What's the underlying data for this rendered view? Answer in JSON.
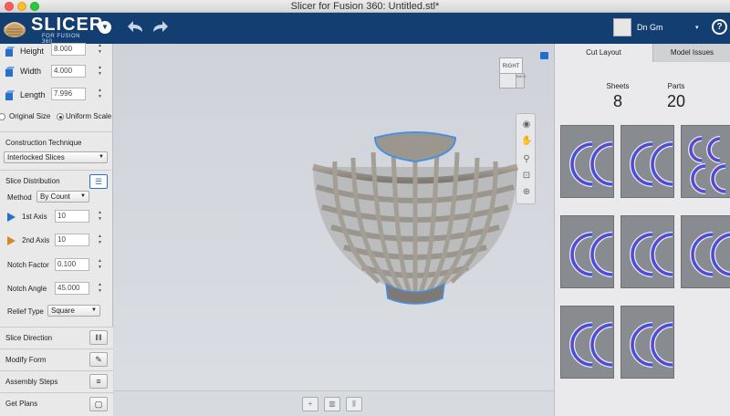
{
  "window": {
    "title": "Slicer for Fusion 360: Untitled.stl*"
  },
  "toolbar": {
    "logo_title": "SLICER",
    "logo_subtitle": "FOR FUSION 360",
    "menu_icon": "chevron-down-icon",
    "user_name": "Dn Gm",
    "user_caret": "▾",
    "help_label": "?"
  },
  "dimensions": {
    "height_label": "Height",
    "height_value": "8.000",
    "width_label": "Width",
    "width_value": "4.000",
    "length_label": "Length",
    "length_value": "7.996"
  },
  "size_mode": {
    "original_label": "Original Size",
    "uniform_label": "Uniform Scale",
    "selected": "Uniform Scale"
  },
  "construction": {
    "title": "Construction Technique",
    "value": "Interlocked Slices"
  },
  "slice_distribution": {
    "title": "Slice Distribution",
    "method_label": "Method",
    "method_value": "By Count",
    "axis1_label": "1st Axis",
    "axis1_value": "10",
    "axis2_label": "2nd Axis",
    "axis2_value": "10",
    "notch_factor_label": "Notch Factor",
    "notch_factor_value": "0.100",
    "notch_angle_label": "Notch Angle",
    "notch_angle_value": "45.000",
    "relief_label": "Relief Type",
    "relief_value": "Square"
  },
  "bottom_items": {
    "slice_direction": "Slice Direction",
    "modify_form": "Modify Form",
    "assembly_steps": "Assembly Steps",
    "get_plans": "Get Plans"
  },
  "viewcube": {
    "front_label": "RIGHT",
    "side_label": "BACK"
  },
  "right_panel": {
    "tab_cut_layout": "Cut Layout",
    "tab_model_issues": "Model Issues",
    "sheets_label": "Sheets",
    "sheets_value": "8",
    "parts_label": "Parts",
    "parts_value": "20"
  },
  "colors": {
    "toolbar_bg": "#123e72",
    "part_fill": "#4a4fd8",
    "part_outline": "#e8e8ff",
    "part_mark": "#e02323"
  }
}
